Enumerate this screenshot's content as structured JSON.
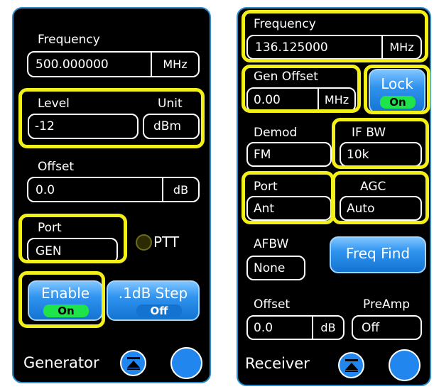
{
  "generator": {
    "frequency": {
      "label": "Frequency",
      "value": "500.000000",
      "unit": "MHz"
    },
    "level": {
      "label": "Level",
      "value": "-12"
    },
    "unit": {
      "label": "Unit",
      "value": "dBm"
    },
    "offset": {
      "label": "Offset",
      "value": "0.0",
      "unit": "dB"
    },
    "port": {
      "label": "Port",
      "value": "GEN"
    },
    "ptt": {
      "label": "PTT"
    },
    "enable": {
      "label": "Enable",
      "state": "On"
    },
    "step": {
      "label": ".1dB Step",
      "state": "Off"
    },
    "footer": {
      "title": "Generator"
    }
  },
  "receiver": {
    "frequency": {
      "label": "Frequency",
      "value": "136.125000",
      "unit": "MHz"
    },
    "gen_offset": {
      "label": "Gen Offset",
      "value": "0.00",
      "unit": "MHz"
    },
    "lock": {
      "label": "Lock",
      "state": "On"
    },
    "demod": {
      "label": "Demod",
      "value": "FM"
    },
    "if_bw": {
      "label": "IF BW",
      "value": "10k"
    },
    "port": {
      "label": "Port",
      "value": "Ant"
    },
    "agc": {
      "label": "AGC",
      "value": "Auto"
    },
    "afbw": {
      "label": "AFBW",
      "value": "None"
    },
    "freq_find": {
      "label": "Freq Find"
    },
    "offset": {
      "label": "Offset",
      "value": "0.0",
      "unit": "dB"
    },
    "preamp": {
      "label": "PreAmp",
      "value": "Off"
    },
    "footer": {
      "title": "Receiver"
    }
  },
  "colors": {
    "highlight": "#f2ef19",
    "panel_border": "#2a8ecf",
    "button_blue": "#2187ee",
    "on_green": "#1ee34a"
  }
}
